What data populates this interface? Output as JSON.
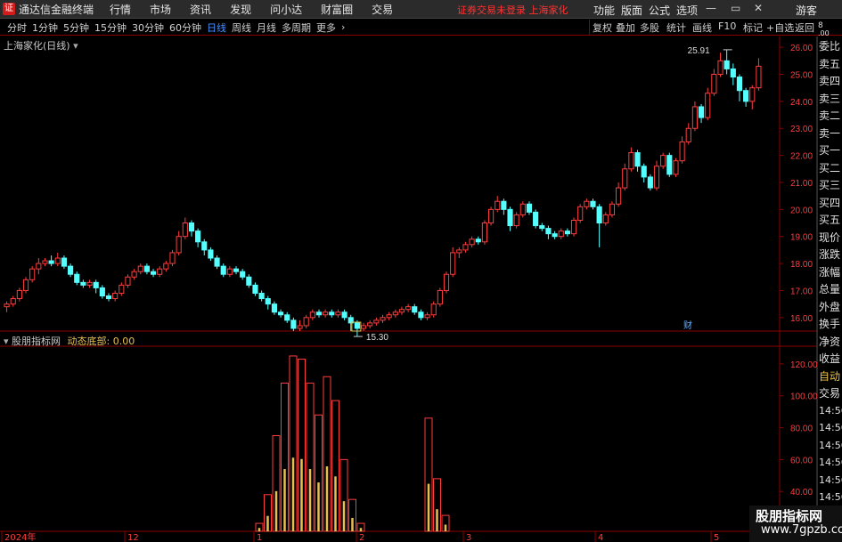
{
  "app": {
    "title": "通达信金融终端",
    "logo_glyph": "证"
  },
  "menu": [
    "行情",
    "市场",
    "资讯",
    "发现",
    "问小达",
    "财富圈",
    "交易"
  ],
  "warning": "证券交易未登录  上海家化",
  "right_menu": [
    "功能",
    "版面",
    "公式",
    "选项"
  ],
  "guest": "游客",
  "toolbar": {
    "periods": [
      "分时",
      "1分钟",
      "5分钟",
      "15分钟",
      "30分钟",
      "60分钟",
      "日线",
      "周线",
      "月线",
      "多周期",
      "更多"
    ],
    "active": "日线",
    "right": [
      "复权",
      "叠加",
      "多股",
      "统计",
      "画线",
      "F10",
      "标记",
      "+自选",
      "返回"
    ]
  },
  "chart_title": "上海家化(日线)",
  "indicator": {
    "name": "股朋指标网",
    "label": "动态底部:",
    "value": "0.00"
  },
  "annotations": {
    "high": "25.91",
    "low": "15.30",
    "cai": "财"
  },
  "right_panel": [
    "委比",
    "卖五",
    "卖四",
    "卖三",
    "卖二",
    "卖一",
    "买一",
    "买二",
    "买三",
    "买四",
    "买五",
    "现价",
    "涨跌",
    "涨幅",
    "总量",
    "外盘",
    "换手",
    "净资",
    "收益",
    "自动",
    "交易",
    "14:56",
    "14:56",
    "14:56",
    "14:56",
    "14:56",
    "14:56",
    "14:56"
  ],
  "corner_labels": [
    "8",
    ".00"
  ],
  "watermark": {
    "line1": "股朋指标网",
    "line2": "www.7gpzb.com"
  },
  "colors": {
    "up": "#ff3d3d",
    "down": "#54ffff",
    "accent": "#4a90ff",
    "axis": "#8b0000",
    "bar_inner": "#e8c050"
  },
  "chart_data": [
    {
      "type": "candlestick",
      "ylim": [
        15.5,
        26.4
      ],
      "yticks": [
        "16.00",
        "17.00",
        "18.00",
        "19.00",
        "20.00",
        "21.00",
        "22.00",
        "23.00",
        "24.00",
        "25.00",
        "26.00"
      ],
      "xlabels": [
        "2024年",
        "12",
        "1",
        "2",
        "3",
        "4",
        "5"
      ],
      "candles": [
        [
          16.4,
          16.5,
          16.2,
          16.6
        ],
        [
          16.5,
          16.7,
          16.4,
          16.8
        ],
        [
          16.7,
          17.0,
          16.6,
          17.1
        ],
        [
          17.0,
          17.4,
          16.9,
          17.5
        ],
        [
          17.4,
          17.8,
          17.3,
          17.9
        ],
        [
          17.8,
          18.0,
          17.6,
          18.2
        ],
        [
          18.0,
          18.1,
          17.9,
          18.2
        ],
        [
          18.1,
          18.0,
          17.9,
          18.3
        ],
        [
          18.0,
          18.2,
          17.9,
          18.4
        ],
        [
          18.2,
          17.9,
          17.8,
          18.3
        ],
        [
          17.9,
          17.6,
          17.5,
          18.0
        ],
        [
          17.6,
          17.3,
          17.2,
          17.7
        ],
        [
          17.3,
          17.2,
          17.1,
          17.4
        ],
        [
          17.2,
          17.3,
          17.1,
          17.4
        ],
        [
          17.3,
          17.1,
          16.9,
          17.4
        ],
        [
          17.1,
          16.8,
          16.7,
          17.2
        ],
        [
          16.8,
          16.7,
          16.6,
          16.9
        ],
        [
          16.7,
          16.9,
          16.6,
          17.0
        ],
        [
          16.9,
          17.2,
          16.8,
          17.3
        ],
        [
          17.2,
          17.5,
          17.1,
          17.6
        ],
        [
          17.5,
          17.7,
          17.4,
          17.8
        ],
        [
          17.7,
          17.9,
          17.6,
          18.0
        ],
        [
          17.9,
          17.7,
          17.6,
          18.0
        ],
        [
          17.7,
          17.6,
          17.5,
          17.8
        ],
        [
          17.6,
          17.8,
          17.5,
          17.9
        ],
        [
          17.8,
          18.0,
          17.7,
          18.1
        ],
        [
          18.0,
          18.4,
          17.9,
          18.5
        ],
        [
          18.4,
          19.0,
          18.3,
          19.2
        ],
        [
          19.0,
          19.5,
          18.9,
          19.7
        ],
        [
          19.5,
          19.2,
          19.0,
          19.6
        ],
        [
          19.2,
          18.8,
          18.6,
          19.3
        ],
        [
          18.8,
          18.5,
          18.3,
          18.9
        ],
        [
          18.5,
          18.2,
          18.1,
          18.6
        ],
        [
          18.2,
          17.9,
          17.8,
          18.3
        ],
        [
          17.9,
          17.6,
          17.5,
          18.0
        ],
        [
          17.6,
          17.8,
          17.5,
          17.9
        ],
        [
          17.8,
          17.7,
          17.6,
          17.9
        ],
        [
          17.7,
          17.5,
          17.4,
          17.8
        ],
        [
          17.5,
          17.2,
          17.1,
          17.6
        ],
        [
          17.2,
          16.9,
          16.8,
          17.3
        ],
        [
          16.9,
          16.7,
          16.6,
          17.0
        ],
        [
          16.7,
          16.5,
          16.3,
          16.8
        ],
        [
          16.5,
          16.2,
          16.1,
          16.6
        ],
        [
          16.2,
          16.1,
          16.0,
          16.3
        ],
        [
          16.1,
          15.9,
          15.8,
          16.2
        ],
        [
          15.9,
          15.6,
          15.5,
          16.0
        ],
        [
          15.6,
          15.7,
          15.5,
          15.9
        ],
        [
          15.7,
          16.0,
          15.6,
          16.1
        ],
        [
          16.0,
          16.2,
          15.9,
          16.3
        ],
        [
          16.2,
          16.1,
          16.0,
          16.3
        ],
        [
          16.1,
          16.2,
          16.0,
          16.3
        ],
        [
          16.2,
          16.1,
          16.0,
          16.3
        ],
        [
          16.1,
          16.2,
          16.0,
          16.3
        ],
        [
          16.2,
          16.0,
          15.9,
          16.3
        ],
        [
          16.0,
          15.8,
          15.5,
          16.1
        ],
        [
          15.8,
          15.6,
          15.3,
          15.9
        ],
        [
          15.6,
          15.7,
          15.5,
          15.8
        ],
        [
          15.7,
          15.8,
          15.6,
          15.9
        ],
        [
          15.8,
          15.9,
          15.7,
          16.0
        ],
        [
          15.9,
          16.0,
          15.8,
          16.1
        ],
        [
          16.0,
          16.1,
          15.9,
          16.2
        ],
        [
          16.1,
          16.2,
          16.0,
          16.3
        ],
        [
          16.2,
          16.3,
          16.1,
          16.4
        ],
        [
          16.3,
          16.4,
          16.2,
          16.5
        ],
        [
          16.4,
          16.2,
          16.1,
          16.5
        ],
        [
          16.2,
          16.0,
          15.9,
          16.3
        ],
        [
          16.0,
          16.1,
          15.9,
          16.2
        ],
        [
          16.1,
          16.5,
          16.0,
          16.6
        ],
        [
          16.5,
          17.0,
          16.4,
          17.1
        ],
        [
          17.0,
          17.6,
          16.9,
          17.7
        ],
        [
          17.6,
          18.4,
          17.5,
          18.6
        ],
        [
          18.4,
          18.5,
          18.2,
          18.6
        ],
        [
          18.5,
          18.7,
          18.4,
          18.8
        ],
        [
          18.7,
          18.9,
          18.6,
          19.0
        ],
        [
          18.9,
          18.8,
          18.7,
          19.0
        ],
        [
          18.8,
          19.5,
          18.7,
          19.6
        ],
        [
          19.5,
          20.0,
          19.4,
          20.1
        ],
        [
          20.0,
          20.3,
          19.9,
          20.5
        ],
        [
          20.3,
          20.0,
          19.8,
          20.4
        ],
        [
          20.0,
          19.4,
          19.2,
          20.1
        ],
        [
          19.4,
          19.8,
          19.3,
          19.9
        ],
        [
          19.8,
          20.2,
          19.7,
          20.3
        ],
        [
          20.2,
          19.9,
          19.8,
          20.3
        ],
        [
          19.9,
          19.4,
          19.3,
          20.0
        ],
        [
          19.4,
          19.3,
          19.2,
          19.5
        ],
        [
          19.3,
          19.1,
          18.9,
          19.4
        ],
        [
          19.1,
          19.0,
          18.9,
          19.2
        ],
        [
          19.0,
          19.2,
          18.9,
          19.3
        ],
        [
          19.2,
          19.1,
          19.0,
          19.3
        ],
        [
          19.1,
          19.6,
          19.0,
          19.7
        ],
        [
          19.6,
          20.1,
          19.5,
          20.2
        ],
        [
          20.1,
          20.3,
          20.0,
          20.4
        ],
        [
          20.3,
          20.1,
          20.0,
          20.4
        ],
        [
          20.1,
          19.5,
          18.6,
          20.2
        ],
        [
          19.5,
          19.8,
          19.4,
          19.9
        ],
        [
          19.8,
          20.2,
          19.7,
          20.3
        ],
        [
          20.2,
          20.8,
          20.1,
          21.0
        ],
        [
          20.8,
          21.5,
          20.7,
          21.7
        ],
        [
          21.5,
          22.1,
          21.4,
          22.3
        ],
        [
          22.1,
          21.6,
          21.4,
          22.2
        ],
        [
          21.6,
          21.2,
          21.0,
          21.7
        ],
        [
          21.2,
          20.8,
          20.7,
          21.3
        ],
        [
          20.8,
          21.6,
          20.7,
          21.8
        ],
        [
          21.6,
          22.0,
          21.5,
          22.1
        ],
        [
          22.0,
          21.3,
          21.2,
          22.1
        ],
        [
          21.3,
          21.8,
          21.2,
          21.9
        ],
        [
          21.8,
          22.5,
          21.7,
          22.7
        ],
        [
          22.5,
          23.0,
          22.4,
          23.2
        ],
        [
          23.0,
          23.8,
          22.9,
          24.0
        ],
        [
          23.8,
          23.4,
          23.2,
          23.9
        ],
        [
          23.4,
          24.3,
          23.3,
          24.5
        ],
        [
          24.3,
          25.0,
          24.2,
          25.2
        ],
        [
          25.0,
          25.5,
          24.9,
          25.8
        ],
        [
          25.5,
          25.2,
          25.0,
          25.91
        ],
        [
          25.2,
          24.9,
          24.6,
          25.4
        ],
        [
          24.9,
          24.4,
          24.0,
          25.0
        ],
        [
          24.4,
          24.0,
          23.8,
          24.5
        ],
        [
          24.0,
          24.5,
          23.7,
          24.6
        ],
        [
          24.5,
          25.3,
          24.4,
          25.6
        ]
      ]
    },
    {
      "type": "bar",
      "name": "动态底部",
      "ylim": [
        15,
        130
      ],
      "yticks": [
        "20.00",
        "40.00",
        "60.00",
        "80.00",
        "100.00",
        "120.00"
      ],
      "values": [
        20,
        38,
        75,
        108,
        125,
        123,
        108,
        88,
        112,
        97,
        60,
        35,
        20,
        14,
        9,
        6,
        4,
        3,
        1,
        1,
        86,
        48,
        25,
        10,
        6,
        3,
        2,
        1,
        1,
        1,
        0.5,
        0.5,
        0.3
      ]
    }
  ]
}
